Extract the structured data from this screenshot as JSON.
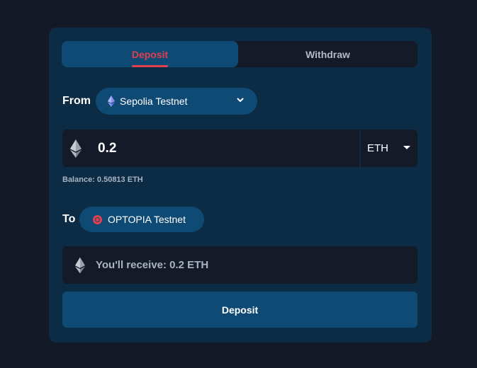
{
  "tabs": {
    "deposit_label": "Deposit",
    "withdraw_label": "Withdraw",
    "active": "Deposit"
  },
  "from": {
    "label": "From",
    "network": "Sepolia Testnet",
    "network_icon": "ethereum-icon"
  },
  "amount": {
    "value": "0.2",
    "token": "ETH",
    "token_icon": "ethereum-icon"
  },
  "balance": {
    "text": "Balance: 0.50813 ETH"
  },
  "to": {
    "label": "To",
    "network": "OPTOPIA Testnet",
    "network_icon": "optopia-logo-icon"
  },
  "receive": {
    "text": "You'll receive: 0.2 ETH"
  },
  "actions": {
    "deposit_label": "Deposit"
  },
  "colors": {
    "background": "#141927",
    "card": "#0c2b44",
    "accent_blue": "#0e4a74",
    "accent_red": "#e23f4f",
    "muted_text": "#a9b4c2"
  }
}
